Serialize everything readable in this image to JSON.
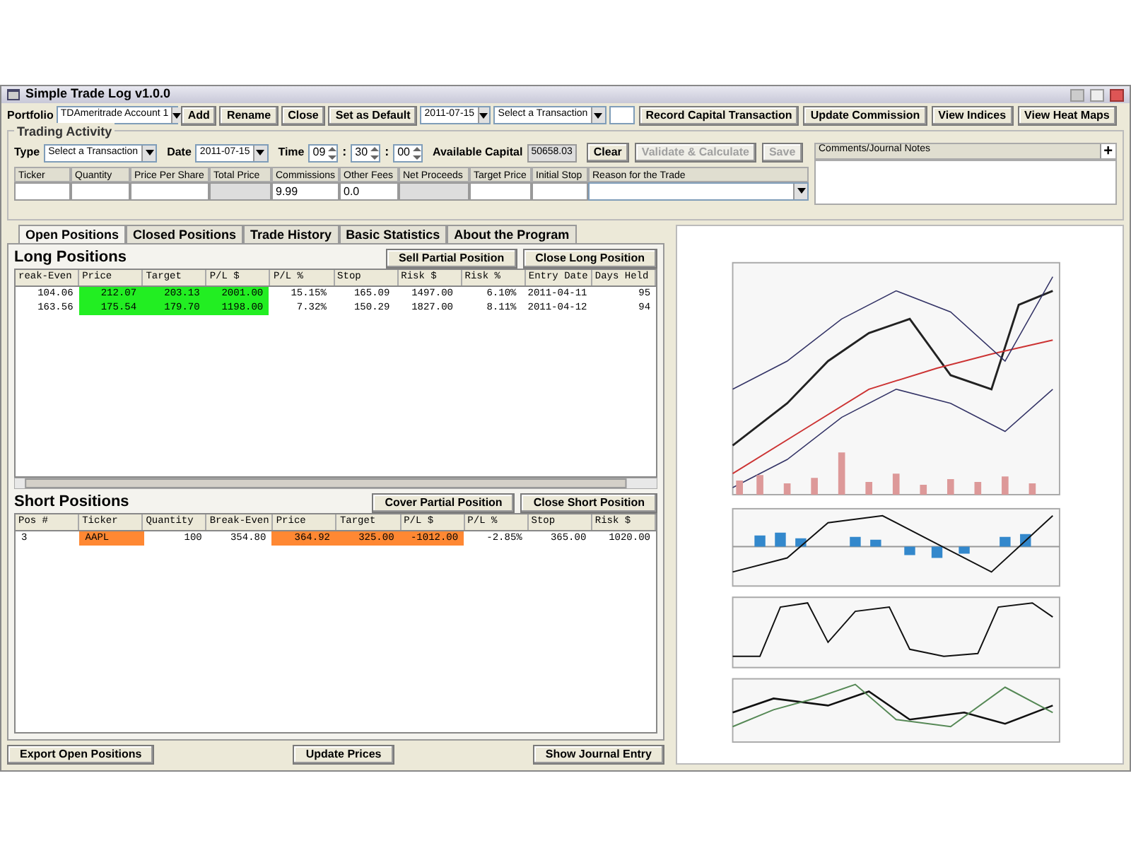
{
  "window": {
    "title": "Simple Trade Log v1.0.0"
  },
  "toolbar": {
    "portfolio_label": "Portfolio",
    "portfolio": "TDAmeritrade Account 1",
    "buttons": [
      "Add",
      "Rename",
      "Close",
      "Set as Default"
    ],
    "date": "2011-07-15",
    "transaction": "Select a Transaction",
    "actions": [
      "Record Capital Transaction",
      "Update Commission",
      "View Indices",
      "View Heat Maps"
    ]
  },
  "trading_activity": {
    "title": "Trading Activity",
    "type_label": "Type",
    "type": "Select a Transaction",
    "date_label": "Date",
    "date": "2011-07-15",
    "time_label": "Time",
    "time": [
      "09",
      "30",
      "00"
    ],
    "time_separators": [
      ":",
      ":"
    ],
    "capital_label": "Available Capital",
    "capital": "50658.03",
    "buttons": [
      {
        "label": "Clear",
        "disabled": false
      },
      {
        "label": "Validate & Calculate",
        "disabled": true
      },
      {
        "label": "Save",
        "disabled": true
      }
    ],
    "fields": [
      {
        "label": "Ticker",
        "kind": "input"
      },
      {
        "label": "Quantity",
        "kind": "input"
      },
      {
        "label": "Price Per Share",
        "kind": "input"
      },
      {
        "label": "Total Price",
        "kind": "readonly"
      },
      {
        "label": "Commissions",
        "kind": "input",
        "value": "9.99"
      },
      {
        "label": "Other Fees",
        "kind": "input",
        "value": "0.0"
      },
      {
        "label": "Net Proceeds",
        "kind": "readonly"
      },
      {
        "label": "Target Price",
        "kind": "input"
      },
      {
        "label": "Initial Stop",
        "kind": "input"
      },
      {
        "label": "Reason for the Trade",
        "kind": "dropdown"
      }
    ],
    "notes_label": "Comments/Journal Notes",
    "add_symbol": "+"
  },
  "tabs": [
    {
      "label": "Open Positions",
      "selected": true
    },
    {
      "label": "Closed Positions",
      "selected": false
    },
    {
      "label": "Trade History",
      "selected": false
    },
    {
      "label": "Basic Statistics",
      "selected": false
    },
    {
      "label": "About the Program",
      "selected": false
    }
  ],
  "long_positions": {
    "title": "Long Positions",
    "buttons": [
      "Sell Partial Position",
      "Close Long Position"
    ],
    "columns": [
      "reak-Even",
      "Price",
      "Target",
      "P/L $",
      "P/L %",
      "Stop",
      "Risk $",
      "Risk %",
      "Entry Date",
      "Days Held"
    ],
    "rows": [
      [
        {
          "text": "104.06"
        },
        {
          "text": "212.07",
          "color": "#22ee22"
        },
        {
          "text": "203.13",
          "color": "#22ee22"
        },
        {
          "text": "2001.00",
          "color": "#22ee22"
        },
        {
          "text": "15.15%"
        },
        {
          "text": "165.09"
        },
        {
          "text": "1497.00"
        },
        {
          "text": "6.10%"
        },
        {
          "text": "2011-04-11"
        },
        {
          "text": "95"
        }
      ],
      [
        {
          "text": "163.56"
        },
        {
          "text": "175.54",
          "color": "#22ee22"
        },
        {
          "text": "179.70",
          "color": "#22ee22"
        },
        {
          "text": "1198.00",
          "color": "#22ee22"
        },
        {
          "text": "7.32%"
        },
        {
          "text": "150.29"
        },
        {
          "text": "1827.00"
        },
        {
          "text": "8.11%"
        },
        {
          "text": "2011-04-12"
        },
        {
          "text": "94"
        }
      ]
    ]
  },
  "short_positions": {
    "title": "Short Positions",
    "buttons": [
      "Cover Partial Position",
      "Close Short Position"
    ],
    "columns": [
      "Pos #",
      "Ticker",
      "Quantity",
      "Break-Even",
      "Price",
      "Target",
      "P/L $",
      "P/L %",
      "Stop",
      "Risk $"
    ],
    "rows": [
      [
        {
          "text": "3"
        },
        {
          "text": "AAPL",
          "color": "#ff8833"
        },
        {
          "text": "100"
        },
        {
          "text": "354.80"
        },
        {
          "text": "364.92",
          "color": "#ff8833"
        },
        {
          "text": "325.00",
          "color": "#ff8833"
        },
        {
          "text": "-1012.00",
          "color": "#ff8833"
        },
        {
          "text": "-2.85%"
        },
        {
          "text": "365.00"
        },
        {
          "text": "1020.00"
        }
      ]
    ]
  },
  "bottom_buttons": [
    "Export Open Positions",
    "Update Prices",
    "Show Journal Entry"
  ],
  "chart_panel": {
    "kind": "picture"
  }
}
